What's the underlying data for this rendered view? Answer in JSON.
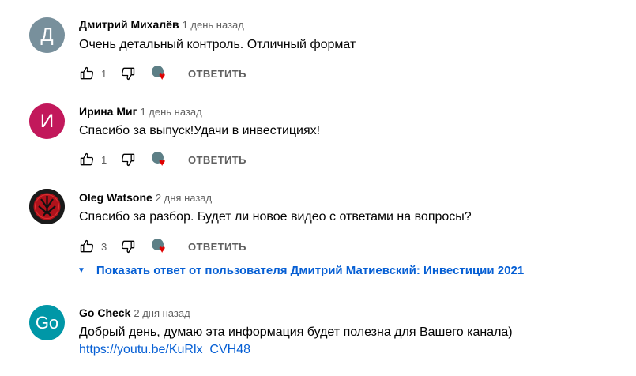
{
  "comments": [
    {
      "author": "Дмитрий Михалёв",
      "time": "1 день назад",
      "text": "Очень детальный контроль. Отличный формат",
      "likes": "1",
      "reply": "ОТВЕТИТЬ",
      "avatar_letter": "Д",
      "avatar_color": "#78909c"
    },
    {
      "author": "Ирина Миг",
      "time": "1 день назад",
      "text": "Спасибо за выпуск!Удачи в инвестициях!",
      "likes": "1",
      "reply": "ОТВЕТИТЬ",
      "avatar_letter": "И",
      "avatar_color": "#c2185b"
    },
    {
      "author": "Oleg Watsone",
      "time": "2 дня назад",
      "text": "Спасибо за разбор. Будет ли новое видео с ответами на вопросы?",
      "likes": "3",
      "reply": "ОТВЕТИТЬ",
      "show_reply": "Показать ответ от пользователя Дмитрий Матиевский: Инвестиции 2021"
    },
    {
      "author": "Go Check",
      "time": "2 дня назад",
      "text": "Добрый день, думаю эта информация будет полезна для Вашего канала)",
      "link": "https://youtu.be/KuRlx_CVH48",
      "avatar_letter": "Go",
      "avatar_color": "#0097a7"
    }
  ],
  "colors": {
    "link": "#065fd4",
    "heart": "#e00000"
  }
}
